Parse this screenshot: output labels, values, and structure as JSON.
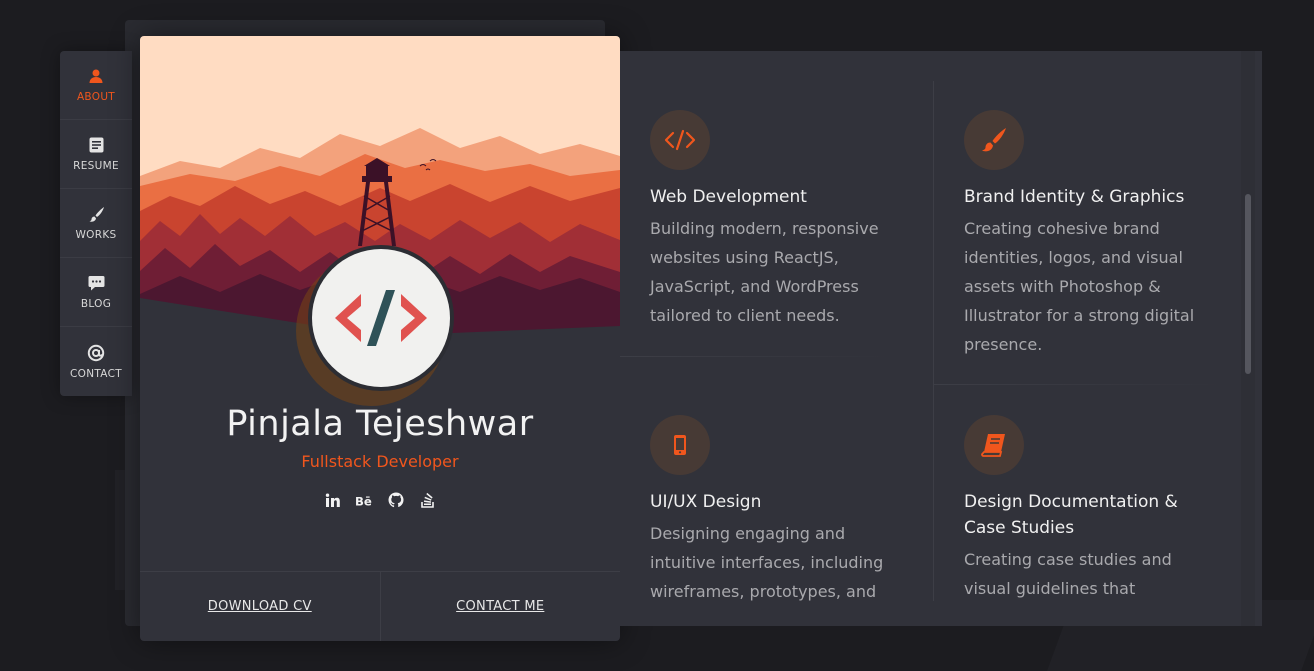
{
  "colors": {
    "accent": "#f0561d",
    "background": "#1c1c20",
    "panel": "#31323a"
  },
  "nav": {
    "items": [
      {
        "label": "ABOUT",
        "icon": "user-icon",
        "active": true
      },
      {
        "label": "RESUME",
        "icon": "document-icon",
        "active": false
      },
      {
        "label": "WORKS",
        "icon": "brush-icon",
        "active": false
      },
      {
        "label": "BLOG",
        "icon": "chat-icon",
        "active": false
      },
      {
        "label": "CONTACT",
        "icon": "at-icon",
        "active": false
      }
    ]
  },
  "profile": {
    "name": "Pinjala Tejeshwar",
    "role": "Fullstack Developer",
    "avatar_icon": "code-brackets-icon",
    "socials": [
      {
        "icon": "linkedin-icon"
      },
      {
        "icon": "behance-icon"
      },
      {
        "icon": "github-icon"
      },
      {
        "icon": "stackoverflow-icon"
      }
    ],
    "actions": {
      "download_cv": "DOWNLOAD CV",
      "contact_me": "CONTACT ME"
    }
  },
  "services": [
    {
      "icon": "code-icon",
      "title": "Web Development",
      "description": "Building modern, responsive websites using ReactJS, JavaScript, and WordPress tailored to client needs."
    },
    {
      "icon": "brush-icon",
      "title": "Brand Identity & Graphics",
      "description": "Creating cohesive brand identities, logos, and visual assets with Photoshop & Illustrator for a strong digital presence."
    },
    {
      "icon": "mobile-icon",
      "title": "UI/UX Design",
      "description": "Designing engaging and intuitive interfaces, including wireframes, prototypes, and"
    },
    {
      "icon": "book-icon",
      "title": "Design Documentation & Case Studies",
      "description": "Creating case studies and visual guidelines that"
    }
  ]
}
